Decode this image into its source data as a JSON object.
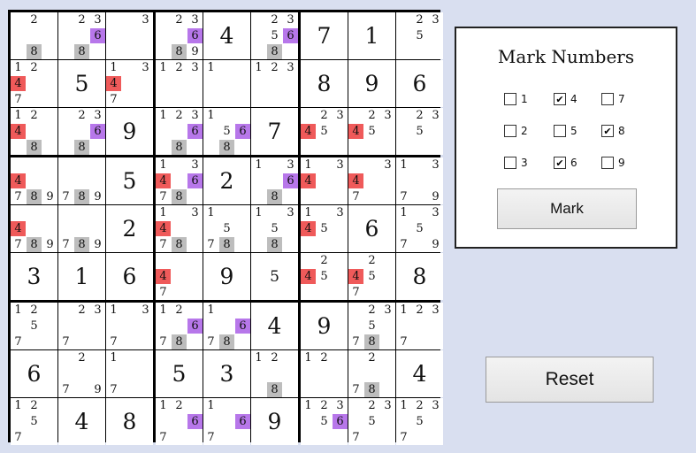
{
  "board": {
    "cells": [
      [
        {
          "v": "",
          "c": [
            2,
            8
          ],
          "h": {
            "8": "g"
          }
        },
        {
          "v": "",
          "c": [
            2,
            3,
            6,
            8
          ],
          "h": {
            "6": "p",
            "8": "g"
          }
        },
        {
          "v": "",
          "c": [
            3
          ]
        },
        {
          "v": "",
          "c": [
            2,
            3,
            6,
            8,
            9
          ],
          "h": {
            "6": "p",
            "8": "g"
          }
        },
        {
          "v": "4"
        },
        {
          "v": "",
          "c": [
            2,
            3,
            5,
            6,
            8
          ],
          "h": {
            "6": "p",
            "8": "g"
          }
        },
        {
          "v": "7"
        },
        {
          "v": "1"
        },
        {
          "v": "",
          "c": [
            2,
            3,
            5
          ]
        }
      ],
      [
        {
          "v": "",
          "c": [
            1,
            2,
            4,
            7
          ],
          "h": {
            "4": "r"
          }
        },
        {
          "v": "5"
        },
        {
          "v": "",
          "c": [
            1,
            3,
            4,
            7
          ],
          "h": {
            "4": "r"
          }
        },
        {
          "v": "",
          "c": [
            1,
            2,
            3
          ]
        },
        {
          "v": "",
          "c": [
            1
          ]
        },
        {
          "v": "",
          "c": [
            1,
            2,
            3
          ]
        },
        {
          "v": "8"
        },
        {
          "v": "9"
        },
        {
          "v": "6"
        }
      ],
      [
        {
          "v": "",
          "c": [
            1,
            2,
            4,
            8
          ],
          "h": {
            "4": "r",
            "8": "g"
          }
        },
        {
          "v": "",
          "c": [
            2,
            3,
            6,
            8
          ],
          "h": {
            "6": "p",
            "8": "g"
          }
        },
        {
          "v": "9"
        },
        {
          "v": "",
          "c": [
            1,
            2,
            3,
            6,
            8
          ],
          "h": {
            "6": "p",
            "8": "g"
          }
        },
        {
          "v": "",
          "c": [
            1,
            5,
            6,
            8
          ],
          "h": {
            "6": "p",
            "8": "g"
          }
        },
        {
          "v": "7"
        },
        {
          "v": "",
          "c": [
            2,
            3,
            4,
            5
          ],
          "h": {
            "4": "r"
          }
        },
        {
          "v": "",
          "c": [
            2,
            3,
            4,
            5
          ],
          "h": {
            "4": "r"
          }
        },
        {
          "v": "",
          "c": [
            2,
            3,
            5
          ]
        }
      ],
      [
        {
          "v": "",
          "c": [
            4,
            7,
            8,
            9
          ],
          "h": {
            "4": "r",
            "8": "g"
          }
        },
        {
          "v": "",
          "c": [
            7,
            8,
            9
          ],
          "h": {
            "8": "g"
          }
        },
        {
          "v": "5"
        },
        {
          "v": "",
          "c": [
            1,
            3,
            4,
            6,
            7,
            8
          ],
          "h": {
            "4": "r",
            "6": "p",
            "8": "g"
          }
        },
        {
          "v": "2"
        },
        {
          "v": "",
          "c": [
            1,
            3,
            6,
            8
          ],
          "h": {
            "6": "p",
            "8": "g"
          }
        },
        {
          "v": "",
          "c": [
            1,
            3,
            4
          ],
          "h": {
            "4": "r"
          }
        },
        {
          "v": "",
          "c": [
            3,
            4,
            7
          ],
          "h": {
            "4": "r"
          }
        },
        {
          "v": "",
          "c": [
            1,
            3,
            7,
            9
          ]
        }
      ],
      [
        {
          "v": "",
          "c": [
            4,
            7,
            8,
            9
          ],
          "h": {
            "4": "r",
            "8": "g"
          }
        },
        {
          "v": "",
          "c": [
            7,
            8,
            9
          ],
          "h": {
            "8": "g"
          }
        },
        {
          "v": "2"
        },
        {
          "v": "",
          "c": [
            1,
            3,
            4,
            7,
            8
          ],
          "h": {
            "4": "r",
            "8": "g"
          }
        },
        {
          "v": "",
          "c": [
            1,
            5,
            7,
            8
          ],
          "h": {
            "8": "g"
          }
        },
        {
          "v": "",
          "c": [
            1,
            3,
            5,
            8
          ],
          "h": {
            "8": "g"
          }
        },
        {
          "v": "",
          "c": [
            1,
            3,
            4,
            5
          ],
          "h": {
            "4": "r"
          }
        },
        {
          "v": "6"
        },
        {
          "v": "",
          "c": [
            1,
            3,
            5,
            7,
            9
          ]
        }
      ],
      [
        {
          "v": "3"
        },
        {
          "v": "1"
        },
        {
          "v": "6"
        },
        {
          "v": "",
          "c": [
            4,
            7
          ],
          "h": {
            "4": "r"
          }
        },
        {
          "v": "9"
        },
        {
          "v": "5",
          "small": true
        },
        {
          "v": "",
          "c": [
            2,
            4,
            5
          ],
          "h": {
            "4": "r"
          }
        },
        {
          "v": "",
          "c": [
            2,
            4,
            5,
            7
          ],
          "h": {
            "4": "r"
          }
        },
        {
          "v": "8"
        }
      ],
      [
        {
          "v": "",
          "c": [
            1,
            2,
            5,
            7
          ]
        },
        {
          "v": "",
          "c": [
            2,
            3,
            7
          ]
        },
        {
          "v": "",
          "c": [
            1,
            3,
            7
          ]
        },
        {
          "v": "",
          "c": [
            1,
            2,
            6,
            7,
            8
          ],
          "h": {
            "6": "p",
            "8": "g"
          }
        },
        {
          "v": "",
          "c": [
            1,
            6,
            7,
            8
          ],
          "h": {
            "6": "p",
            "8": "g"
          }
        },
        {
          "v": "4"
        },
        {
          "v": "9"
        },
        {
          "v": "",
          "c": [
            2,
            3,
            5,
            7,
            8
          ],
          "h": {
            "8": "g"
          }
        },
        {
          "v": "",
          "c": [
            1,
            2,
            3,
            7
          ]
        }
      ],
      [
        {
          "v": "6"
        },
        {
          "v": "",
          "c": [
            2,
            7,
            9
          ]
        },
        {
          "v": "",
          "c": [
            1,
            7
          ]
        },
        {
          "v": "5"
        },
        {
          "v": "3"
        },
        {
          "v": "",
          "c": [
            1,
            2,
            8
          ],
          "h": {
            "8": "g"
          }
        },
        {
          "v": "",
          "c": [
            1,
            2
          ]
        },
        {
          "v": "",
          "c": [
            2,
            7,
            8
          ],
          "h": {
            "8": "g"
          }
        },
        {
          "v": "4"
        }
      ],
      [
        {
          "v": "",
          "c": [
            1,
            2,
            5,
            7
          ]
        },
        {
          "v": "4"
        },
        {
          "v": "8"
        },
        {
          "v": "",
          "c": [
            1,
            2,
            6,
            7
          ],
          "h": {
            "6": "p"
          }
        },
        {
          "v": "",
          "c": [
            1,
            6,
            7
          ],
          "h": {
            "6": "p"
          }
        },
        {
          "v": "9"
        },
        {
          "v": "",
          "c": [
            1,
            2,
            3,
            5,
            6
          ],
          "h": {
            "6": "p"
          }
        },
        {
          "v": "",
          "c": [
            2,
            3,
            5,
            7
          ]
        },
        {
          "v": "",
          "c": [
            1,
            2,
            3,
            5,
            7
          ]
        }
      ]
    ]
  },
  "mark_panel": {
    "title": "Mark Numbers",
    "options": [
      {
        "label": "1",
        "checked": false
      },
      {
        "label": "4",
        "checked": true
      },
      {
        "label": "7",
        "checked": false
      },
      {
        "label": "2",
        "checked": false
      },
      {
        "label": "5",
        "checked": false
      },
      {
        "label": "8",
        "checked": true
      },
      {
        "label": "3",
        "checked": false
      },
      {
        "label": "6",
        "checked": true
      },
      {
        "label": "9",
        "checked": false
      }
    ],
    "mark_label": "Mark"
  },
  "reset_label": "Reset"
}
